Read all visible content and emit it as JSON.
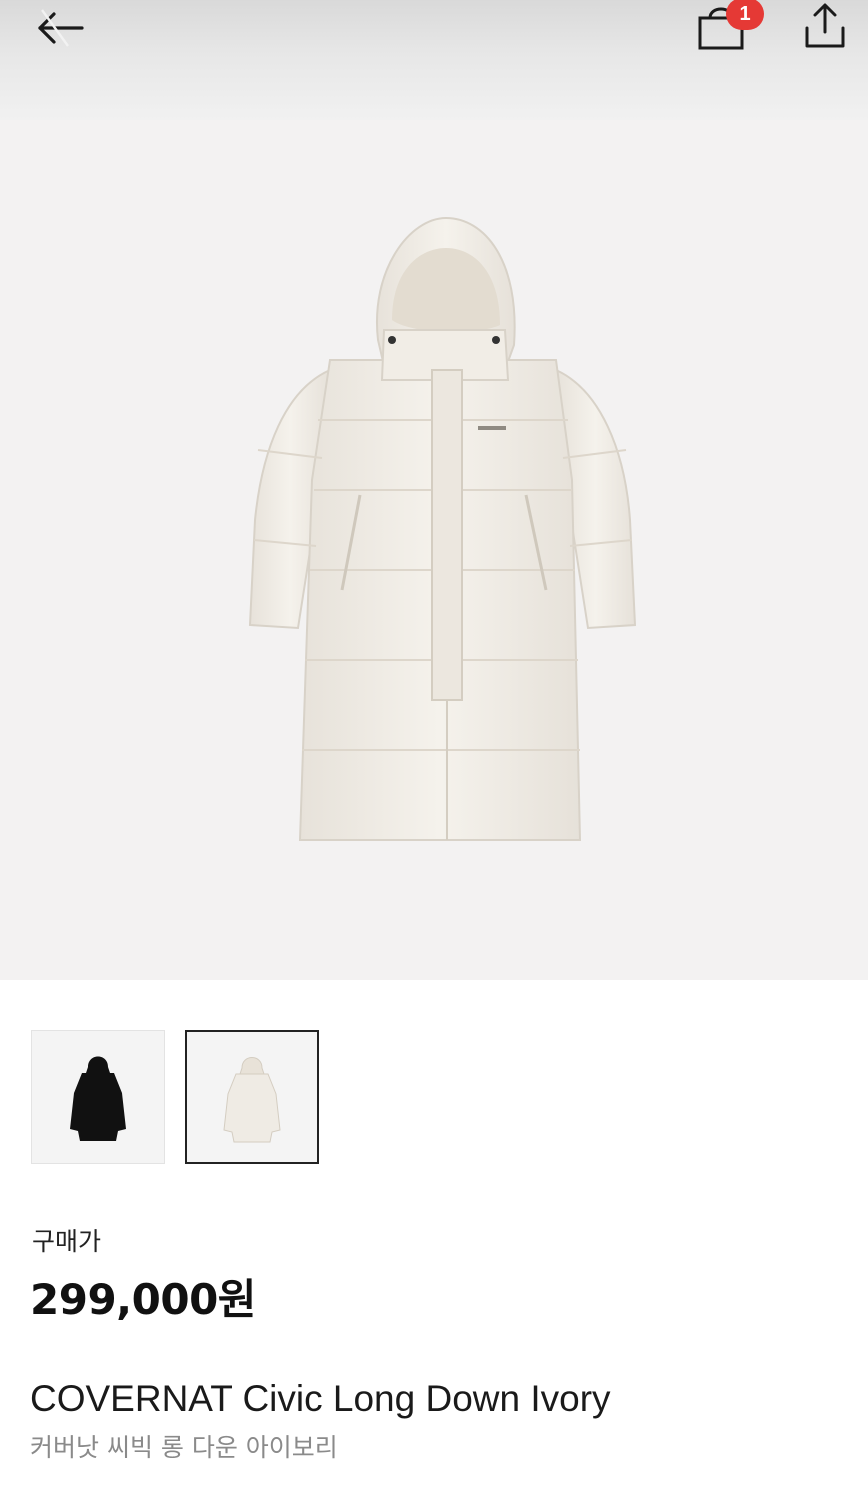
{
  "header": {
    "cart_count": "1"
  },
  "product": {
    "price_label": "구매가",
    "price": "299,000원",
    "name_en": "COVERNAT Civic Long Down Ivory",
    "name_ko": "커버낫 씨빅 롱 다운 아이보리"
  },
  "thumbnails": [
    {
      "color": "black",
      "selected": false
    },
    {
      "color": "ivory",
      "selected": true
    }
  ],
  "colors": {
    "badge": "#e53935",
    "hero_bg": "#f3f2f2",
    "jacket_ivory": "#efebe4",
    "jacket_black": "#111111"
  }
}
